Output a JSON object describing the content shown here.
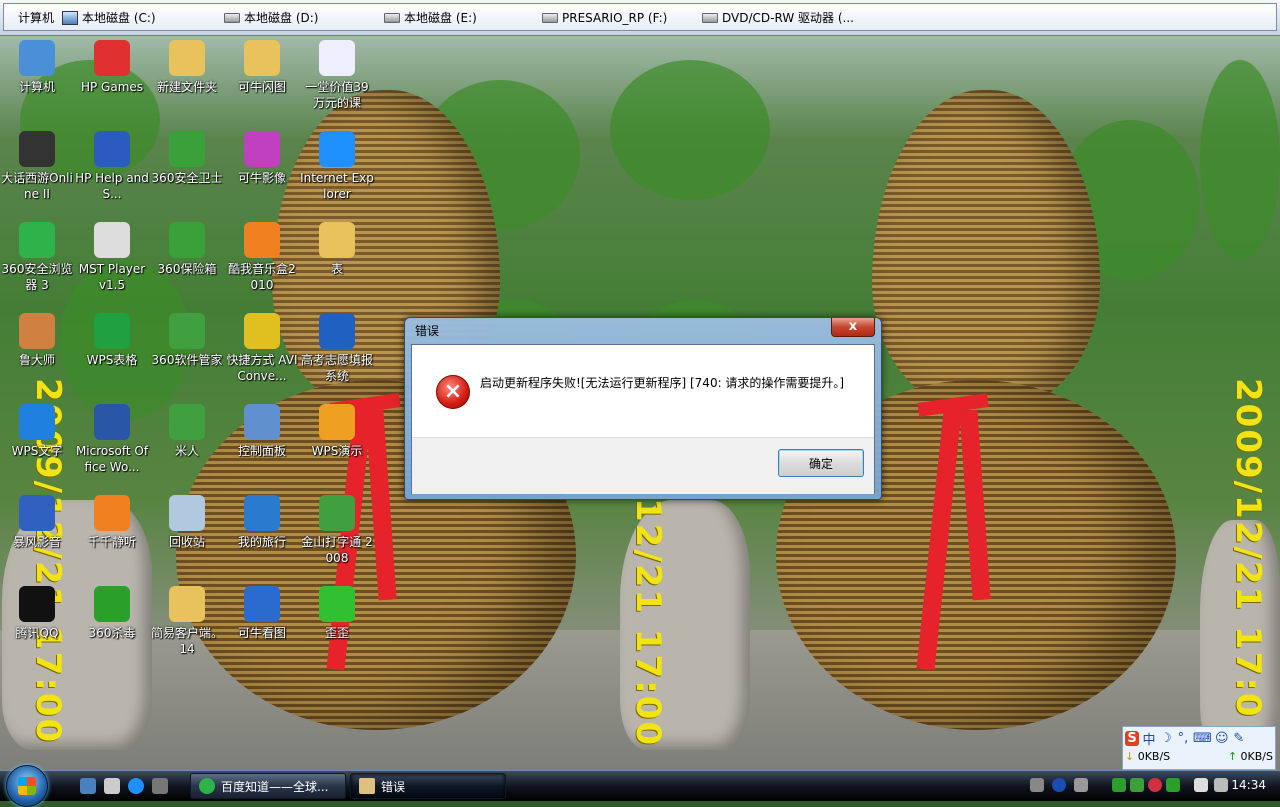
{
  "drivebar": {
    "items": [
      {
        "label": "计算机",
        "icon": "computer-icon"
      },
      {
        "label": "本地磁盘 (C:)",
        "icon": "drive-icon"
      },
      {
        "label": "本地磁盘 (D:)",
        "icon": "drive-icon"
      },
      {
        "label": "本地磁盘 (E:)",
        "icon": "drive-icon"
      },
      {
        "label": "PRESARIO_RP (F:)",
        "icon": "drive-icon"
      },
      {
        "label": "DVD/CD-RW 驱动器 (...",
        "icon": "dvd-drive-icon"
      }
    ]
  },
  "wallpaper": {
    "stamp_left": "2009/12/21 17:00",
    "stamp_mid": "12/21 17:00",
    "stamp_right": "2009/12/21 17:0"
  },
  "desktop_icons": [
    {
      "label": "计算机",
      "icon": "computer-icon"
    },
    {
      "label": "HP Games",
      "icon": "games-icon"
    },
    {
      "label": "新建文件夹",
      "icon": "folder-icon"
    },
    {
      "label": "可牛闪图",
      "icon": "folder-icon"
    },
    {
      "label": "一堂价值39万元的课",
      "icon": "word-document-icon"
    },
    {
      "label": "大话西游Online II",
      "icon": "game-icon"
    },
    {
      "label": "HP Help and S...",
      "icon": "help-icon"
    },
    {
      "label": "360安全卫士",
      "icon": "shield-icon"
    },
    {
      "label": "可牛影像",
      "icon": "photo-app-icon"
    },
    {
      "label": "Internet Explorer",
      "icon": "ie-icon"
    },
    {
      "label": "360安全浏览器 3",
      "icon": "browser-icon"
    },
    {
      "label": "MST Player v1.5",
      "icon": "player-icon"
    },
    {
      "label": "360保险箱",
      "icon": "safe-icon"
    },
    {
      "label": "酷我音乐盒2010",
      "icon": "music-icon"
    },
    {
      "label": "表",
      "icon": "folder-icon"
    },
    {
      "label": "鲁大师",
      "icon": "ludashi-icon"
    },
    {
      "label": "WPS表格",
      "icon": "spreadsheet-icon"
    },
    {
      "label": "360软件管家",
      "icon": "software-manager-icon"
    },
    {
      "label": "快捷方式 AVIConve...",
      "icon": "converter-icon"
    },
    {
      "label": "高考志愿填报系统",
      "icon": "app-icon"
    },
    {
      "label": "WPS文字",
      "icon": "writer-icon"
    },
    {
      "label": "Microsoft Office Wo...",
      "icon": "word-icon"
    },
    {
      "label": "米人",
      "icon": "person-icon"
    },
    {
      "label": "控制面板",
      "icon": "control-panel-icon"
    },
    {
      "label": "WPS演示",
      "icon": "presentation-icon"
    },
    {
      "label": "暴风影音",
      "icon": "media-player-icon"
    },
    {
      "label": "千千静听",
      "icon": "music-player-icon"
    },
    {
      "label": "回收站",
      "icon": "recycle-bin-icon"
    },
    {
      "label": "我的旅行",
      "icon": "travel-icon"
    },
    {
      "label": "金山打字通 2008",
      "icon": "typing-icon"
    },
    {
      "label": "腾讯QQ",
      "icon": "qq-icon"
    },
    {
      "label": "360杀毒",
      "icon": "antivirus-icon"
    },
    {
      "label": "简易客户端。14",
      "icon": "folder-icon"
    },
    {
      "label": "可牛看图",
      "icon": "eye-icon"
    },
    {
      "label": "歪歪",
      "icon": "yy-icon"
    }
  ],
  "dialog": {
    "title": "错误",
    "close_label": "x",
    "message": "启动更新程序失败![无法运行更新程序] [740: 请求的操作需要提升。]",
    "ok_label": "确定"
  },
  "ime": {
    "logo": "S",
    "chinese_label": "中",
    "down_speed": "0KB/S",
    "up_speed": "0KB/S"
  },
  "taskbar": {
    "tasks": [
      {
        "label": "百度知道——全球..."
      },
      {
        "label": "错误"
      }
    ],
    "clock": "14:34"
  }
}
